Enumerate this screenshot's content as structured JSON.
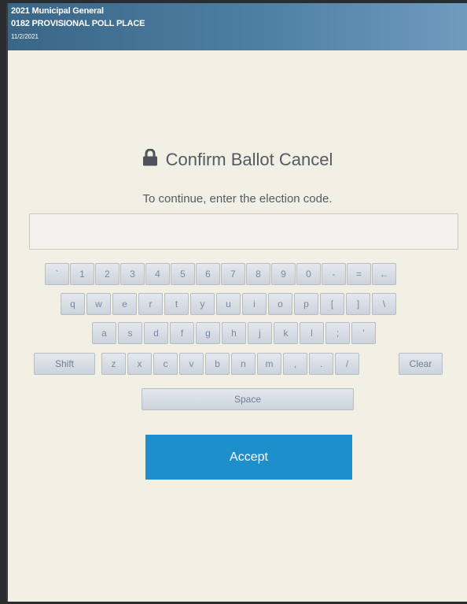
{
  "header": {
    "line1": "2021 Municipal General",
    "line2": "0182 PROVISIONAL POLL PLACE",
    "date": "11/2/2021"
  },
  "dialog": {
    "title": "Confirm Ballot Cancel",
    "subtitle": "To continue, enter the election code.",
    "icon": "lock-icon",
    "code_value": ""
  },
  "keyboard": {
    "row1": [
      "`",
      "1",
      "2",
      "3",
      "4",
      "5",
      "6",
      "7",
      "8",
      "9",
      "0",
      "-",
      "=",
      "←"
    ],
    "row2": [
      "q",
      "w",
      "e",
      "r",
      "t",
      "y",
      "u",
      "i",
      "o",
      "p",
      "[",
      "]",
      "\\"
    ],
    "row3": [
      "a",
      "s",
      "d",
      "f",
      "g",
      "h",
      "j",
      "k",
      "l",
      ";",
      "'"
    ],
    "row4": [
      "Shift",
      "z",
      "x",
      "c",
      "v",
      "b",
      "n",
      "m",
      ",",
      ".",
      "/",
      "Clear"
    ],
    "space": "Space"
  },
  "actions": {
    "accept": "Accept"
  },
  "colors": {
    "header": "#4e7fa3",
    "accent": "#1e8fcd",
    "background": "#f2efe4",
    "key": "#d8dde5"
  }
}
